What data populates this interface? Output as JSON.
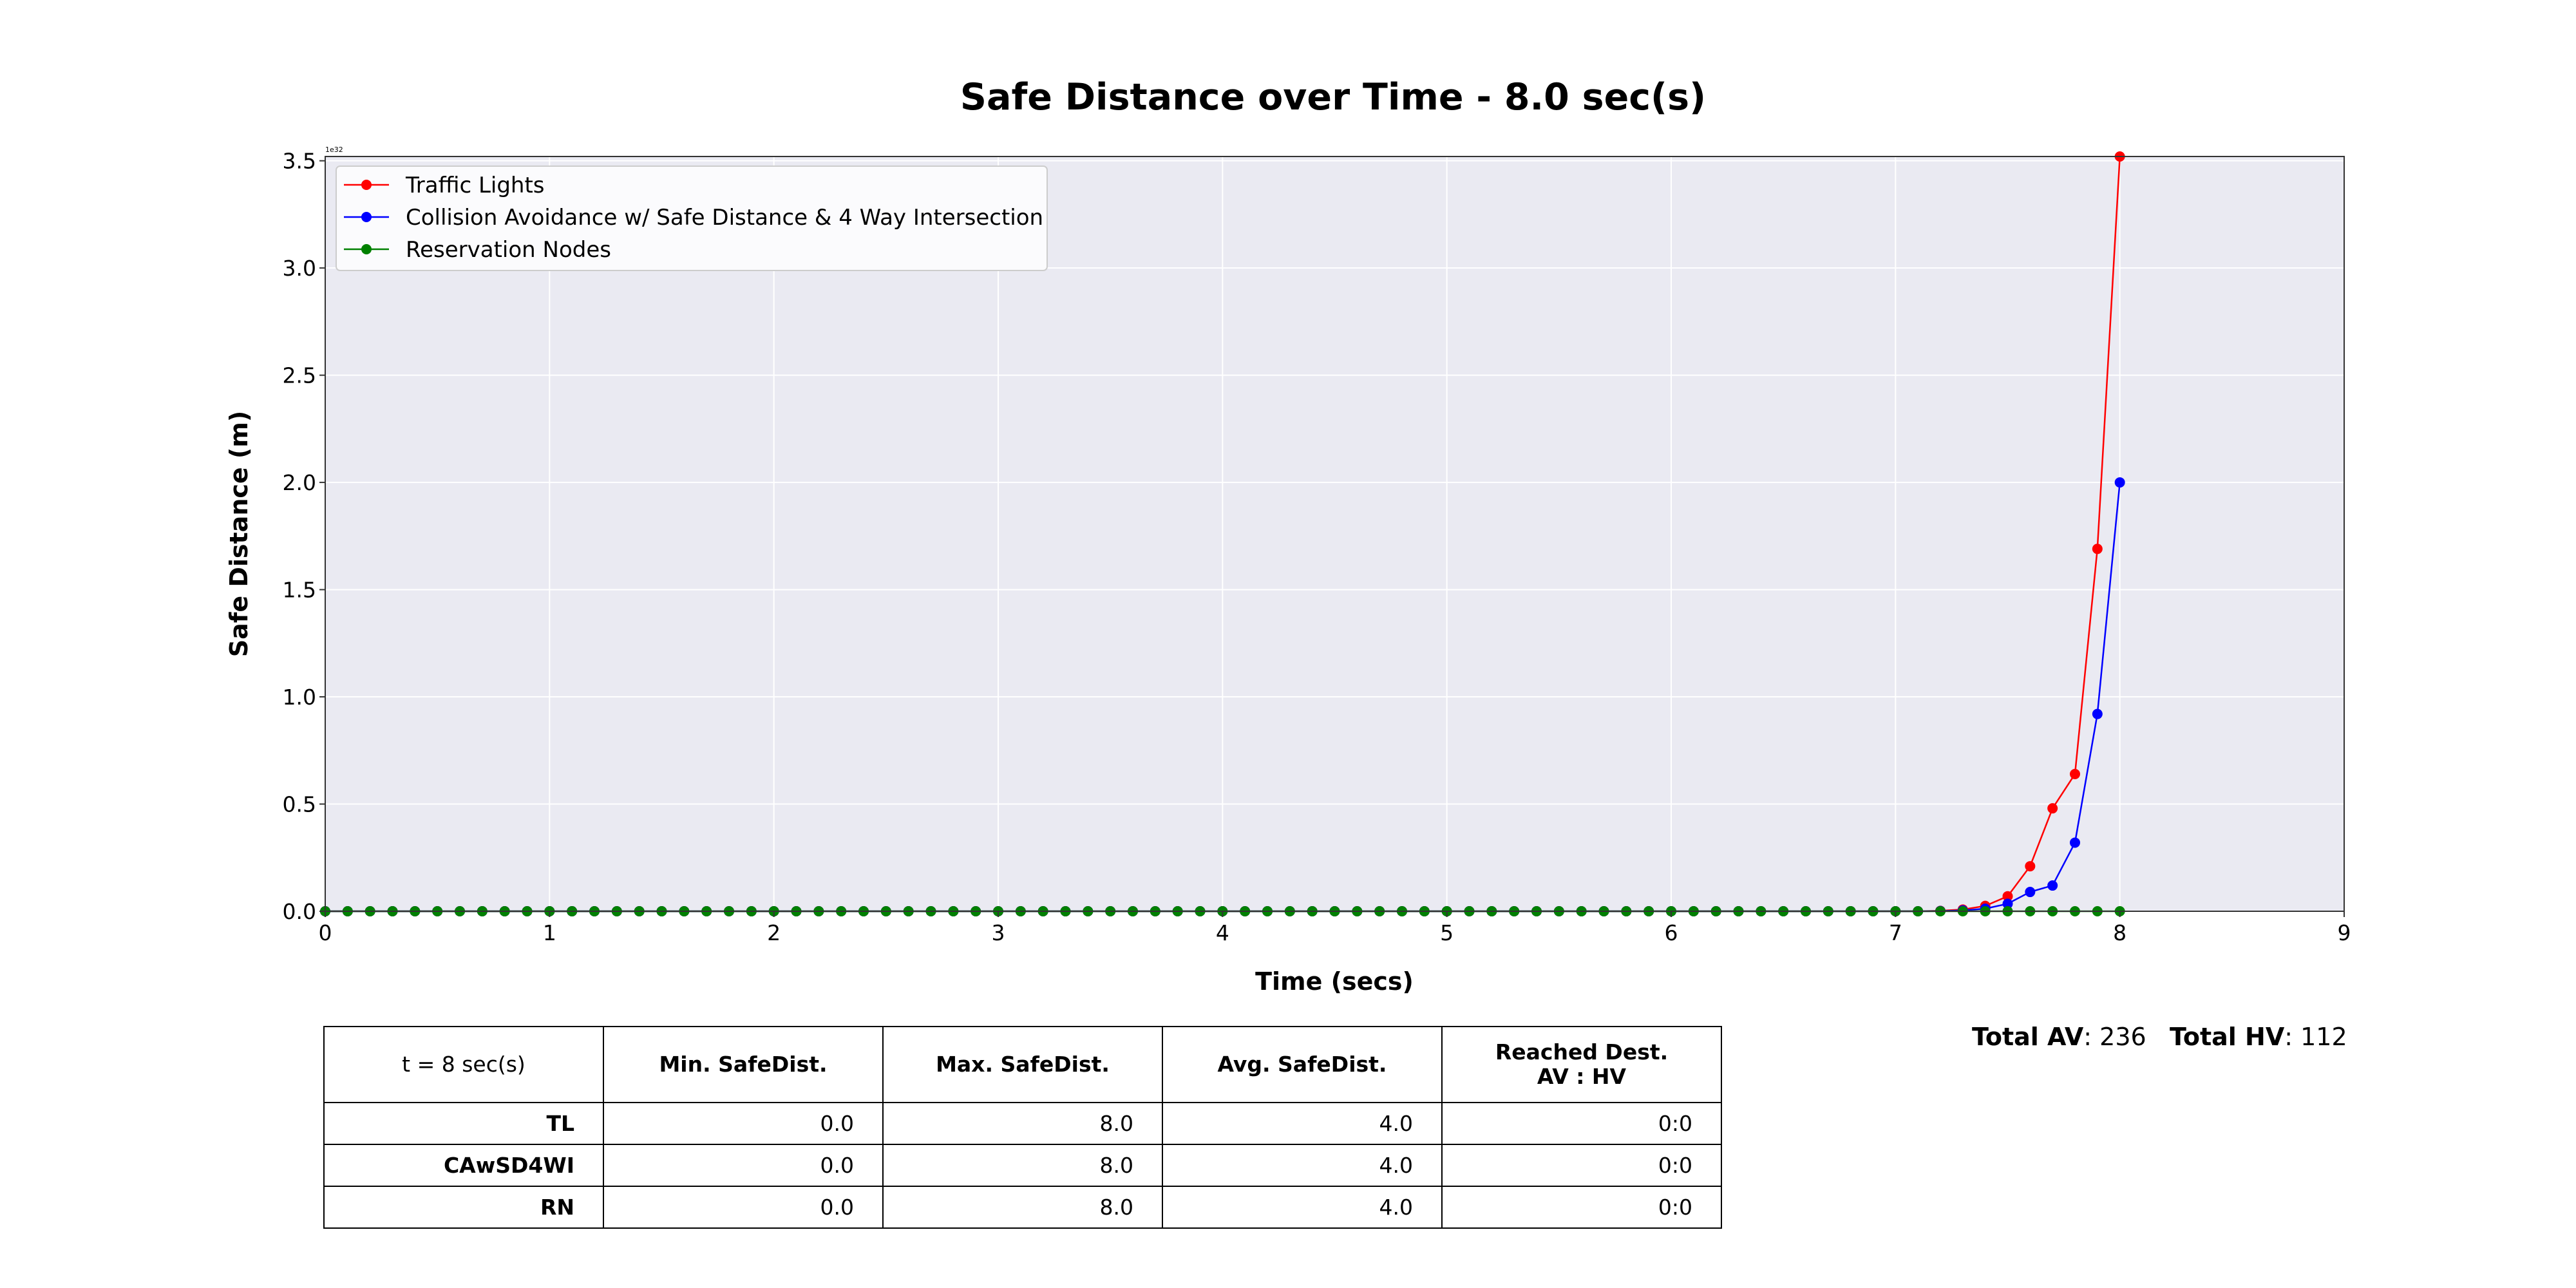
{
  "chart_data": {
    "type": "line",
    "title": "Safe Distance over Time - 8.0 sec(s)",
    "xlabel": "Time (secs)",
    "ylabel": "Safe Distance (m)",
    "xlim": [
      0,
      9
    ],
    "ylim": [
      0,
      3.52
    ],
    "y_scale_label": "1e32",
    "x_ticks": [
      "0",
      "1",
      "2",
      "3",
      "4",
      "5",
      "6",
      "7",
      "8",
      "9"
    ],
    "y_ticks": [
      "0.0",
      "0.5",
      "1.0",
      "1.5",
      "2.0",
      "2.5",
      "3.0",
      "3.5"
    ],
    "grid": true,
    "legend_position": "top-left",
    "x": [
      0.0,
      0.1,
      0.2,
      0.3,
      0.4,
      0.5,
      0.6,
      0.7,
      0.8,
      0.9,
      1.0,
      1.1,
      1.2,
      1.3,
      1.4,
      1.5,
      1.6,
      1.7,
      1.8,
      1.9,
      2.0,
      2.1,
      2.2,
      2.3,
      2.4,
      2.5,
      2.6,
      2.7,
      2.8,
      2.9,
      3.0,
      3.1,
      3.2,
      3.3,
      3.4,
      3.5,
      3.6,
      3.7,
      3.8,
      3.9,
      4.0,
      4.1,
      4.2,
      4.3,
      4.4,
      4.5,
      4.6,
      4.7,
      4.8,
      4.9,
      5.0,
      5.1,
      5.2,
      5.3,
      5.4,
      5.5,
      5.6,
      5.7,
      5.8,
      5.9,
      6.0,
      6.1,
      6.2,
      6.3,
      6.4,
      6.5,
      6.6,
      6.7,
      6.8,
      6.9,
      7.0,
      7.1,
      7.2,
      7.3,
      7.4,
      7.5,
      7.6,
      7.7,
      7.8,
      7.9,
      8.0
    ],
    "series": [
      {
        "name": "Traffic Lights",
        "color": "#ff0000",
        "values": [
          0,
          0,
          0,
          0,
          0,
          0,
          0,
          0,
          0,
          0,
          0,
          0,
          0,
          0,
          0,
          0,
          0,
          0,
          0,
          0,
          0,
          0,
          0,
          0,
          0,
          0,
          0,
          0,
          0,
          0,
          0,
          0,
          0,
          0,
          0,
          0,
          0,
          0,
          0,
          0,
          0,
          0,
          0,
          0,
          0,
          0,
          0,
          0,
          0,
          0,
          0,
          0,
          0,
          0,
          0,
          0,
          0,
          0,
          0,
          0,
          0,
          0,
          0,
          0,
          0,
          0,
          0,
          0,
          0,
          0,
          0,
          0,
          0.002,
          0.008,
          0.025,
          0.07,
          0.21,
          0.48,
          0.64,
          1.69,
          3.52
        ]
      },
      {
        "name": "Collision Avoidance w/ Safe Distance & 4 Way Intersection",
        "color": "#0000ff",
        "values": [
          0,
          0,
          0,
          0,
          0,
          0,
          0,
          0,
          0,
          0,
          0,
          0,
          0,
          0,
          0,
          0,
          0,
          0,
          0,
          0,
          0,
          0,
          0,
          0,
          0,
          0,
          0,
          0,
          0,
          0,
          0,
          0,
          0,
          0,
          0,
          0,
          0,
          0,
          0,
          0,
          0,
          0,
          0,
          0,
          0,
          0,
          0,
          0,
          0,
          0,
          0,
          0,
          0,
          0,
          0,
          0,
          0,
          0,
          0,
          0,
          0,
          0,
          0,
          0,
          0,
          0,
          0,
          0,
          0,
          0,
          0,
          0,
          0.001,
          0.004,
          0.012,
          0.035,
          0.09,
          0.12,
          0.32,
          0.92,
          2.0
        ]
      },
      {
        "name": "Reservation Nodes",
        "color": "#008000",
        "values": [
          0,
          0,
          0,
          0,
          0,
          0,
          0,
          0,
          0,
          0,
          0,
          0,
          0,
          0,
          0,
          0,
          0,
          0,
          0,
          0,
          0,
          0,
          0,
          0,
          0,
          0,
          0,
          0,
          0,
          0,
          0,
          0,
          0,
          0,
          0,
          0,
          0,
          0,
          0,
          0,
          0,
          0,
          0,
          0,
          0,
          0,
          0,
          0,
          0,
          0,
          0,
          0,
          0,
          0,
          0,
          0,
          0,
          0,
          0,
          0,
          0,
          0,
          0,
          0,
          0,
          0,
          0,
          0,
          0,
          0,
          0,
          0,
          0,
          0,
          0,
          0,
          0,
          0,
          0,
          0,
          0
        ]
      }
    ]
  },
  "table": {
    "corner": "t = 8 sec(s)",
    "headers": [
      "Min. SafeDist.",
      "Max. SafeDist.",
      "Avg. SafeDist.",
      "Reached Dest.\nAV : HV"
    ],
    "rows": [
      {
        "label": "TL",
        "cells": [
          "0.0",
          "8.0",
          "4.0",
          "0:0"
        ]
      },
      {
        "label": "CAwSD4WI",
        "cells": [
          "0.0",
          "8.0",
          "4.0",
          "0:0"
        ]
      },
      {
        "label": "RN",
        "cells": [
          "0.0",
          "8.0",
          "4.0",
          "0:0"
        ]
      }
    ]
  },
  "totals": {
    "av_label": "Total AV",
    "av_value": ": 236",
    "hv_label": "Total HV",
    "hv_value": ": 112"
  }
}
